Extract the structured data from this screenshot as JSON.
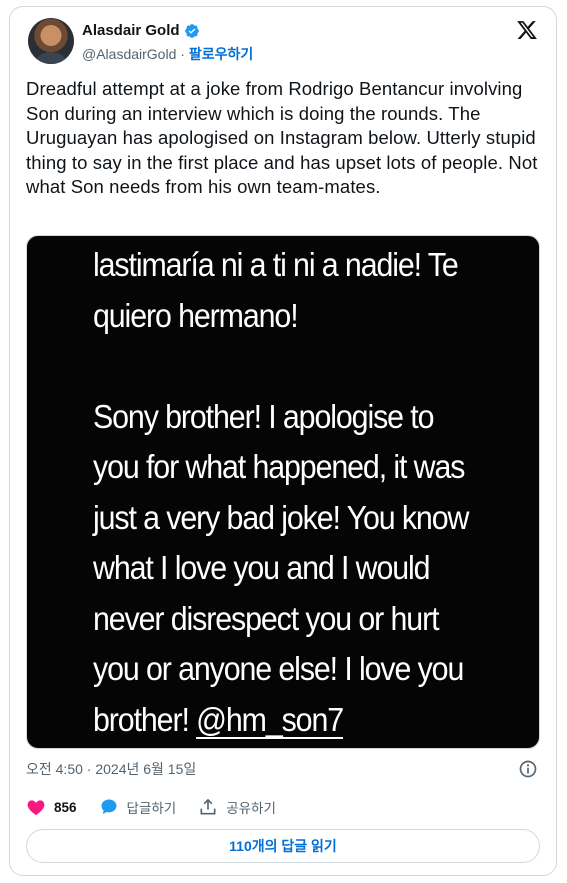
{
  "author": {
    "name": "Alasdair Gold",
    "handle": "@AlasdairGold",
    "separator": "·",
    "follow_label": "팔로우하기"
  },
  "tweet": {
    "text": "Dreadful attempt at a joke from Rodrigo Bentancur involving Son during an interview which is doing the rounds. The Uruguayan has apologised on Instagram below. Utterly stupid thing to say in the first place and has upset lots of people. Not what Son needs from his own team-mates.",
    "timestamp": "오전 4:50 · 2024년 6월 15일"
  },
  "media": {
    "line_1": "lastimaría ni a ti ni a nadie! Te",
    "line_2": "quiero hermano!",
    "line_3": "Sony brother! I apologise to",
    "line_4": "you for what happened, it was",
    "line_5": "just a very bad joke! You know",
    "line_6": "what I love you and I would",
    "line_7": "never disrespect you or hurt",
    "line_8": "you or anyone else! I love you",
    "line_9_prefix": "brother! ",
    "mention": "@hm_son7"
  },
  "actions": {
    "likes": "856",
    "reply_label": "답글하기",
    "share_label": "공유하기"
  },
  "replies_button": "110개의 답글 읽기",
  "colors": {
    "like": "#f91880",
    "reply": "#1d9bf0",
    "link": "#006fd6",
    "verified": "#1d9bf0"
  },
  "icons": [
    "verified-badge-icon",
    "x-logo-icon",
    "info-icon",
    "heart-icon",
    "reply-bubble-icon",
    "share-icon"
  ]
}
